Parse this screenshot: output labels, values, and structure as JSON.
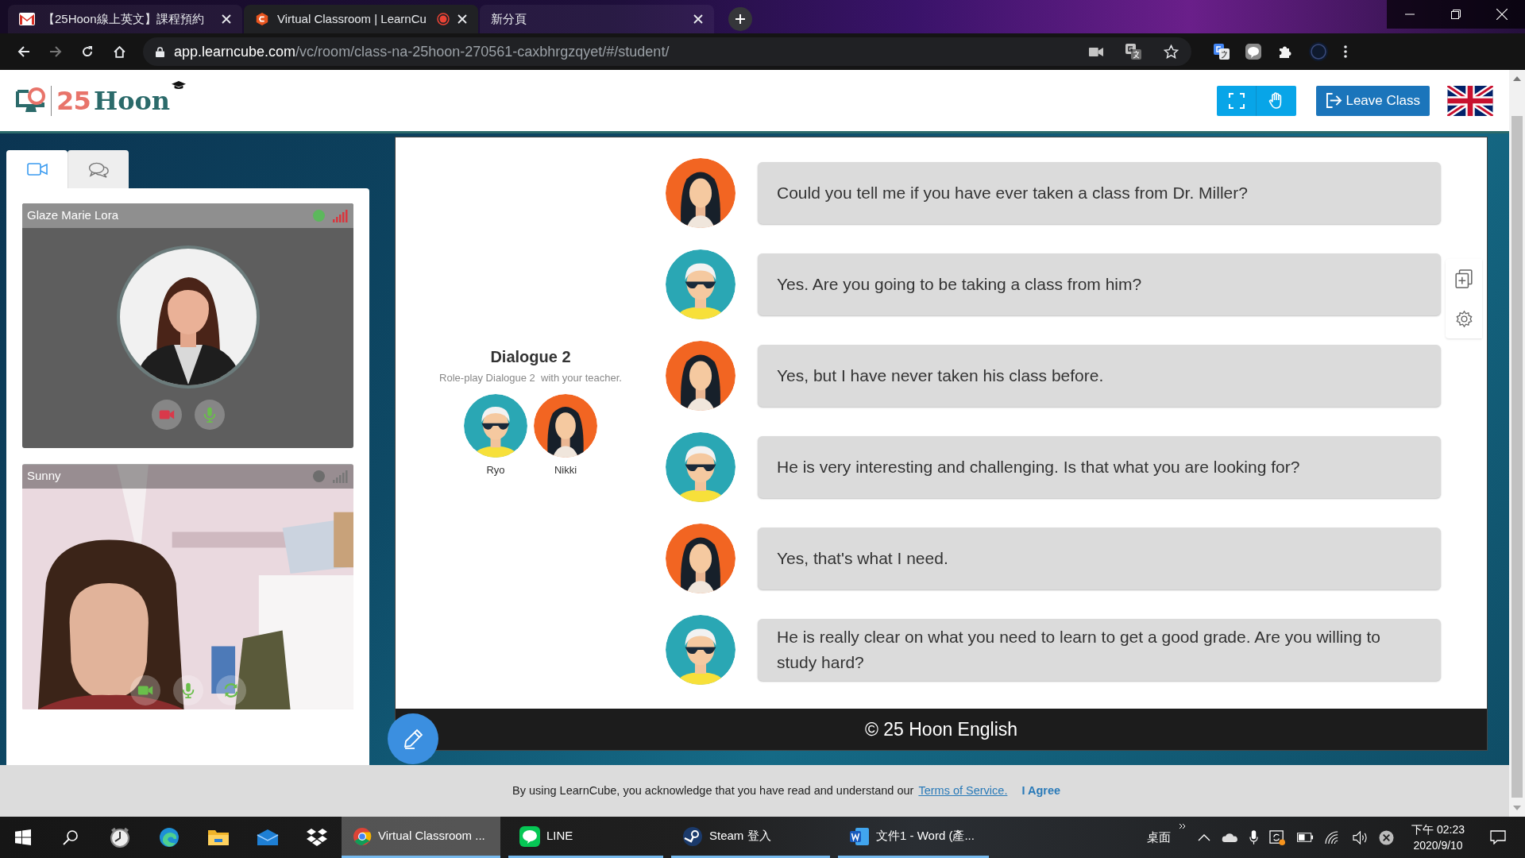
{
  "browser": {
    "tabs": [
      {
        "kind": "mail",
        "title": "【25Hoon線上英文】課程預約",
        "selected": false,
        "recording": false
      },
      {
        "kind": "site",
        "title": "Virtual Classroom | LearnCu",
        "selected": true,
        "recording": true
      },
      {
        "kind": "blank",
        "title": "新分頁",
        "selected": false,
        "recording": false
      }
    ],
    "address": {
      "host": "app.learncube.com",
      "path": "/vc/room/class-na-25hoon-270561-caxbhrgzqyet/#/student/"
    }
  },
  "header": {
    "logo": {
      "number": "25",
      "word": "Hoon"
    },
    "leave_button": "Leave Class"
  },
  "sidebar": {
    "tabs": [
      {
        "kind": "video",
        "selected": true
      },
      {
        "kind": "chat",
        "selected": false
      }
    ],
    "participants": [
      {
        "name": "Glaze Marie Lora",
        "online": true,
        "kind": "avatar",
        "controls": [
          {
            "kind": "camera",
            "on": false
          },
          {
            "kind": "mic",
            "on": true
          }
        ]
      },
      {
        "name": "Sunny",
        "online": false,
        "kind": "camera",
        "controls": [
          {
            "kind": "camera",
            "on": true
          },
          {
            "kind": "mic",
            "on": true
          },
          {
            "kind": "switch",
            "on": true
          }
        ]
      }
    ]
  },
  "slide": {
    "title": "Dialogue 2",
    "subtitle": "Role-play Dialogue 2  with your teacher.",
    "characters": [
      {
        "name": "Ryo",
        "kind": "man"
      },
      {
        "name": "Nikki",
        "kind": "woman"
      }
    ],
    "lines": [
      {
        "kind": "woman",
        "text": "Could you tell me if you have ever taken a class from Dr. Miller?"
      },
      {
        "kind": "man",
        "text": "Yes. Are you going to be taking a class from him?"
      },
      {
        "kind": "woman",
        "text": "Yes, but I have never taken his class before."
      },
      {
        "kind": "man",
        "text": "He is very interesting and challenging. Is that what you are looking for?"
      },
      {
        "kind": "woman",
        "text": "Yes, that's what I need."
      },
      {
        "kind": "man",
        "text": "He is really clear on what you need to learn to get a good grade. Are you willing to study hard?"
      }
    ],
    "footer": "© 25 Hoon English"
  },
  "cookie_bar": {
    "text": "By using LearnCube, you acknowledge that you have read and understand our",
    "link": "Terms of Service.",
    "agree": "I Agree"
  },
  "taskbar": {
    "apps": [
      {
        "kind": "chrome",
        "label": "Virtual Classroom ...",
        "active": true
      },
      {
        "kind": "line",
        "label": "LINE",
        "active": false
      },
      {
        "kind": "steam",
        "label": "Steam 登入",
        "active": false
      },
      {
        "kind": "word",
        "label": "文件1 - Word (產...",
        "active": false
      }
    ],
    "desktop": "桌面",
    "time": "下午 02:23",
    "date": "2020/9/10"
  }
}
